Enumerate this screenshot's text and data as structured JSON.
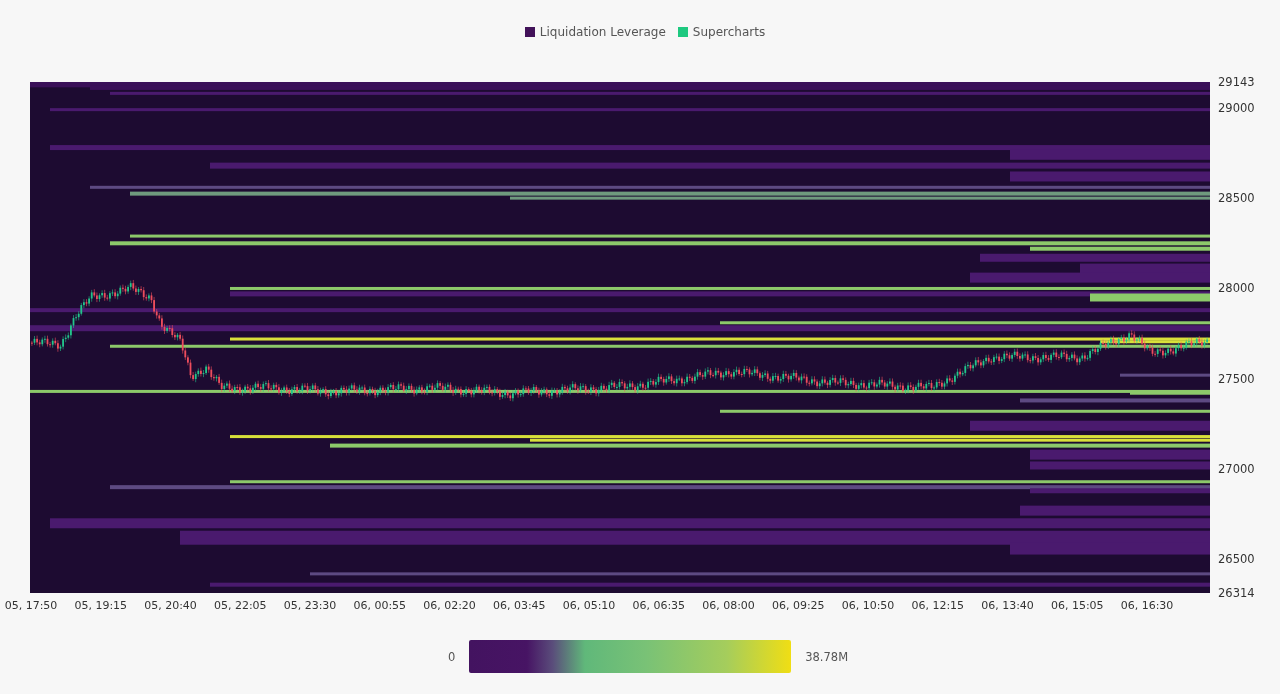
{
  "legend": [
    {
      "label": "Liquidation Leverage",
      "color": "#421259"
    },
    {
      "label": "Supercharts",
      "color": "#1ec980"
    }
  ],
  "chart": {
    "y_labels": [
      "29143",
      "29000",
      "28500",
      "28000",
      "27500",
      "27000",
      "26500",
      "26314"
    ],
    "x_labels": [
      "05, 17:50",
      "05, 19:15",
      "05, 20:40",
      "05, 22:05",
      "05, 23:30",
      "06, 00:55",
      "06, 02:20",
      "06, 03:45",
      "06, 05:10",
      "06, 06:35",
      "06, 08:00",
      "06, 09:25",
      "06, 10:50",
      "06, 12:15",
      "06, 13:40",
      "06, 15:05",
      "06, 16:30"
    ]
  },
  "color_scale": {
    "min_label": "0",
    "max_label": "38.78M"
  }
}
